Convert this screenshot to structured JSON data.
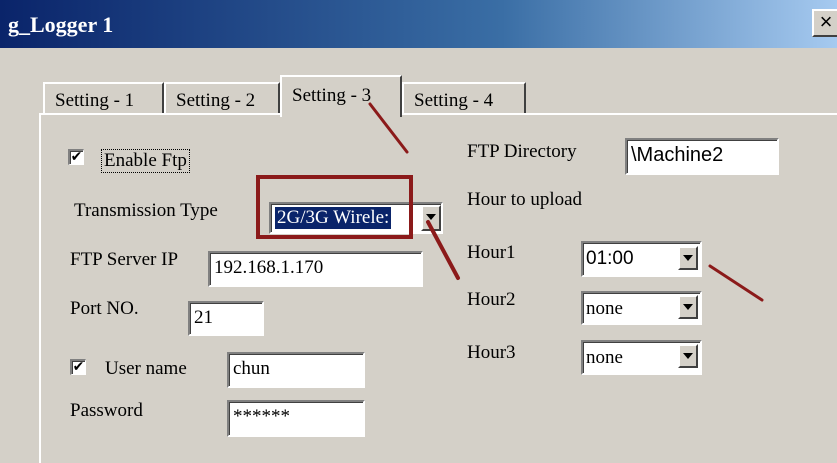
{
  "window": {
    "title": "g_Logger 1",
    "close_glyph": "×"
  },
  "tabs": [
    {
      "label": "Setting - 1"
    },
    {
      "label": "Setting - 2"
    },
    {
      "label": "Setting - 3"
    },
    {
      "label": "Setting - 4"
    }
  ],
  "active_tab": 2,
  "ftp": {
    "enable_label": "Enable Ftp",
    "enable_checked": true,
    "check_glyph": "✔",
    "transmission_type_label": "Transmission Type",
    "transmission_type_value": "2G/3G Wirele:",
    "server_ip_label": "FTP Server IP",
    "server_ip_value": "192.168.1.170",
    "port_label": "Port NO.",
    "port_value": "21",
    "username_label": "User name",
    "username_checked": true,
    "username_value": "chun",
    "password_label": "Password",
    "password_value": "******",
    "directory_label": "FTP Directory",
    "directory_value": "\\Machine2",
    "hour_to_upload_label": "Hour to upload",
    "hours": [
      {
        "label": "Hour1",
        "value": "01:00"
      },
      {
        "label": "Hour2",
        "value": "none"
      },
      {
        "label": "Hour3",
        "value": "none"
      }
    ]
  },
  "annotation_color": "#8b1a1a",
  "icons": {
    "dropdown": "chevron-down-icon",
    "close": "close-icon",
    "check": "check-icon"
  }
}
